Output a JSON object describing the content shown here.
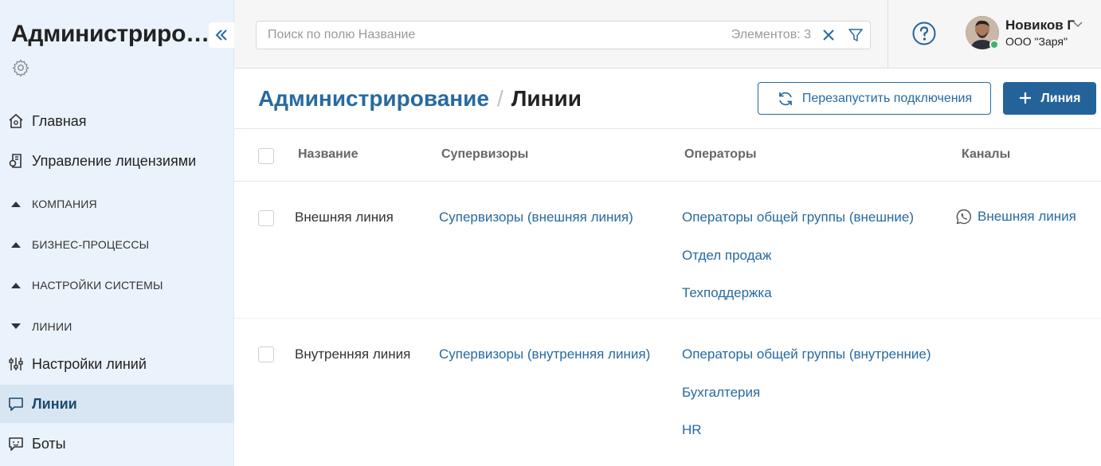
{
  "sidebar": {
    "title": "Администрирование",
    "items": [
      {
        "label": "Главная"
      },
      {
        "label": "Управление лицензиями"
      },
      {
        "label": "Настройки линий"
      },
      {
        "label": "Линии"
      },
      {
        "label": "Боты"
      }
    ],
    "groups": [
      {
        "label": "КОМПАНИЯ"
      },
      {
        "label": "БИЗНЕС-ПРОЦЕССЫ"
      },
      {
        "label": "НАСТРОЙКИ СИСТЕМЫ"
      },
      {
        "label": "ЛИНИИ"
      }
    ]
  },
  "header": {
    "search_placeholder": "Поиск по полю Название",
    "items_count": "Элементов: 3",
    "user_name": "Новиков Г",
    "user_org": "ООО \"Заря\""
  },
  "page": {
    "breadcrumb_root": "Администрирование",
    "breadcrumb_sep": "/",
    "breadcrumb_current": "Линии",
    "restart_label": "Перезапустить подключения",
    "add_label": "Линия"
  },
  "table": {
    "headers": {
      "name": "Название",
      "supervisors": "Супервизоры",
      "operators": "Операторы",
      "channels": "Каналы"
    },
    "rows": [
      {
        "name": "Внешняя линия",
        "supervisors": "Супервизоры (внешняя линия)",
        "operators": [
          "Операторы общей группы (внешние)",
          "Отдел продаж",
          "Техподдержка"
        ],
        "channel": "Внешняя линия"
      },
      {
        "name": "Внутренняя линия",
        "supervisors": "Супервизоры (внутренняя линия)",
        "operators": [
          "Операторы общей группы (внутренние)",
          "Бухгалтерия",
          "HR"
        ],
        "channel": ""
      }
    ]
  },
  "colors": {
    "accent": "#276aa0",
    "primary_button": "#24639a",
    "sidebar_bg": "#eaf2fb",
    "active_item_bg": "#d8e6f3"
  }
}
